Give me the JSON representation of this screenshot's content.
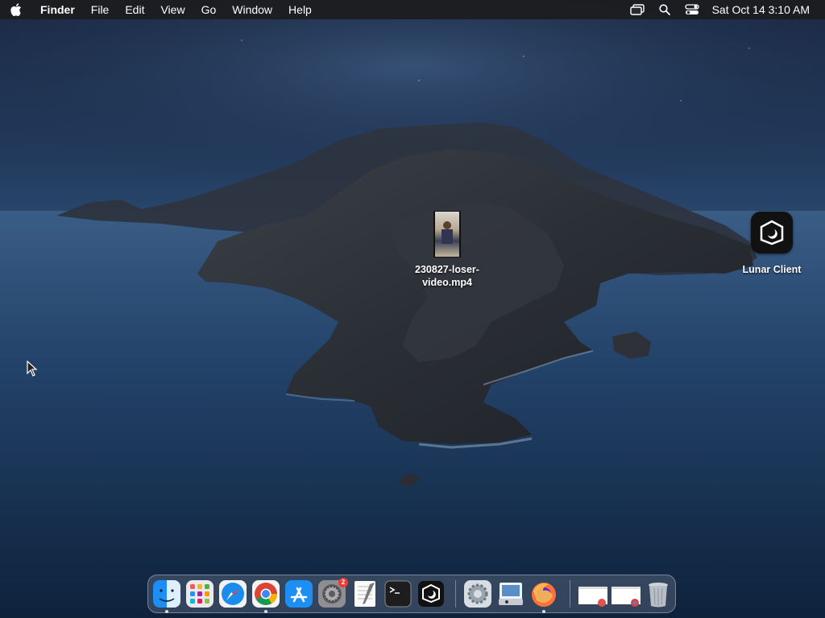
{
  "menubar": {
    "apple_icon": "apple-logo-icon",
    "app_name": "Finder",
    "menus": [
      "File",
      "Edit",
      "View",
      "Go",
      "Window",
      "Help"
    ],
    "status_icons": [
      "screen-mirroring-icon",
      "spotlight-search-icon",
      "control-center-icon"
    ],
    "clock": "Sat Oct 14  3:10 AM"
  },
  "desktop": {
    "wallpaper": "macOS Catalina island",
    "icons": [
      {
        "label": "230827-loser-\nvideo.mp4",
        "icon": "video-file-thumbnail-icon"
      },
      {
        "label": "Lunar Client",
        "icon": "lunar-client-app-icon"
      }
    ],
    "cursor": "arrow-pointer-icon"
  },
  "dock": {
    "apps": [
      {
        "name": "Finder",
        "icon": "finder-icon",
        "running": true
      },
      {
        "name": "Launchpad",
        "icon": "launchpad-icon",
        "running": false
      },
      {
        "name": "Safari",
        "icon": "safari-icon",
        "running": false
      },
      {
        "name": "Google Chrome",
        "icon": "chrome-icon",
        "running": true
      },
      {
        "name": "App Store",
        "icon": "app-store-icon",
        "running": false
      },
      {
        "name": "System Preferences",
        "icon": "system-preferences-icon",
        "running": false,
        "badge": "2"
      },
      {
        "name": "TextEdit",
        "icon": "textedit-icon",
        "running": false
      },
      {
        "name": "Terminal",
        "icon": "terminal-icon",
        "running": false
      },
      {
        "name": "Lunar Client",
        "icon": "lunar-client-icon",
        "running": false
      },
      {
        "name": "Settings",
        "icon": "settings-gear-icon",
        "running": false
      },
      {
        "name": "Preview",
        "icon": "preview-icon",
        "running": false
      },
      {
        "name": "Firefox",
        "icon": "firefox-icon",
        "running": true
      },
      {
        "name": "Minimized Window 1",
        "icon": "minimized-window-icon",
        "running": false
      },
      {
        "name": "Minimized Window 2",
        "icon": "minimized-window-chrome-icon",
        "running": false
      },
      {
        "name": "Trash",
        "icon": "trash-icon",
        "running": false
      }
    ]
  },
  "colors": {
    "menubar_bg": "#1c1c1e",
    "badge_red": "#ee3b36",
    "sea_dark": "#0f2440",
    "sky": "#2a4a70"
  }
}
